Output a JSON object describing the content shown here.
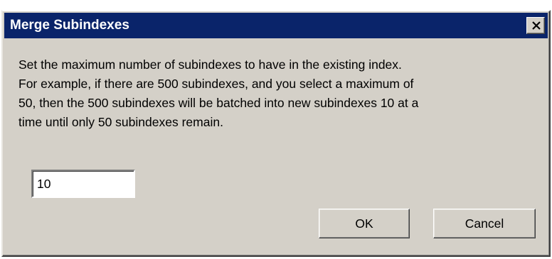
{
  "window": {
    "title": "Merge Subindexes",
    "close_icon": "close-icon"
  },
  "message": {
    "lines": [
      "Set the maximum number of subindexes to have in the existing index.",
      "For example, if there are 500 subindexes, and you select a maximum of",
      "50, then the 500 subindexes will be batched into new subindexes 10 at a",
      "time until only 50 subindexes remain."
    ]
  },
  "max_subindexes": {
    "value": "10"
  },
  "buttons": {
    "ok": "OK",
    "cancel": "Cancel"
  },
  "colors": {
    "titlebar": "#0a246a",
    "dialog_face": "#d4d0c8",
    "title_text": "#ffffff"
  }
}
